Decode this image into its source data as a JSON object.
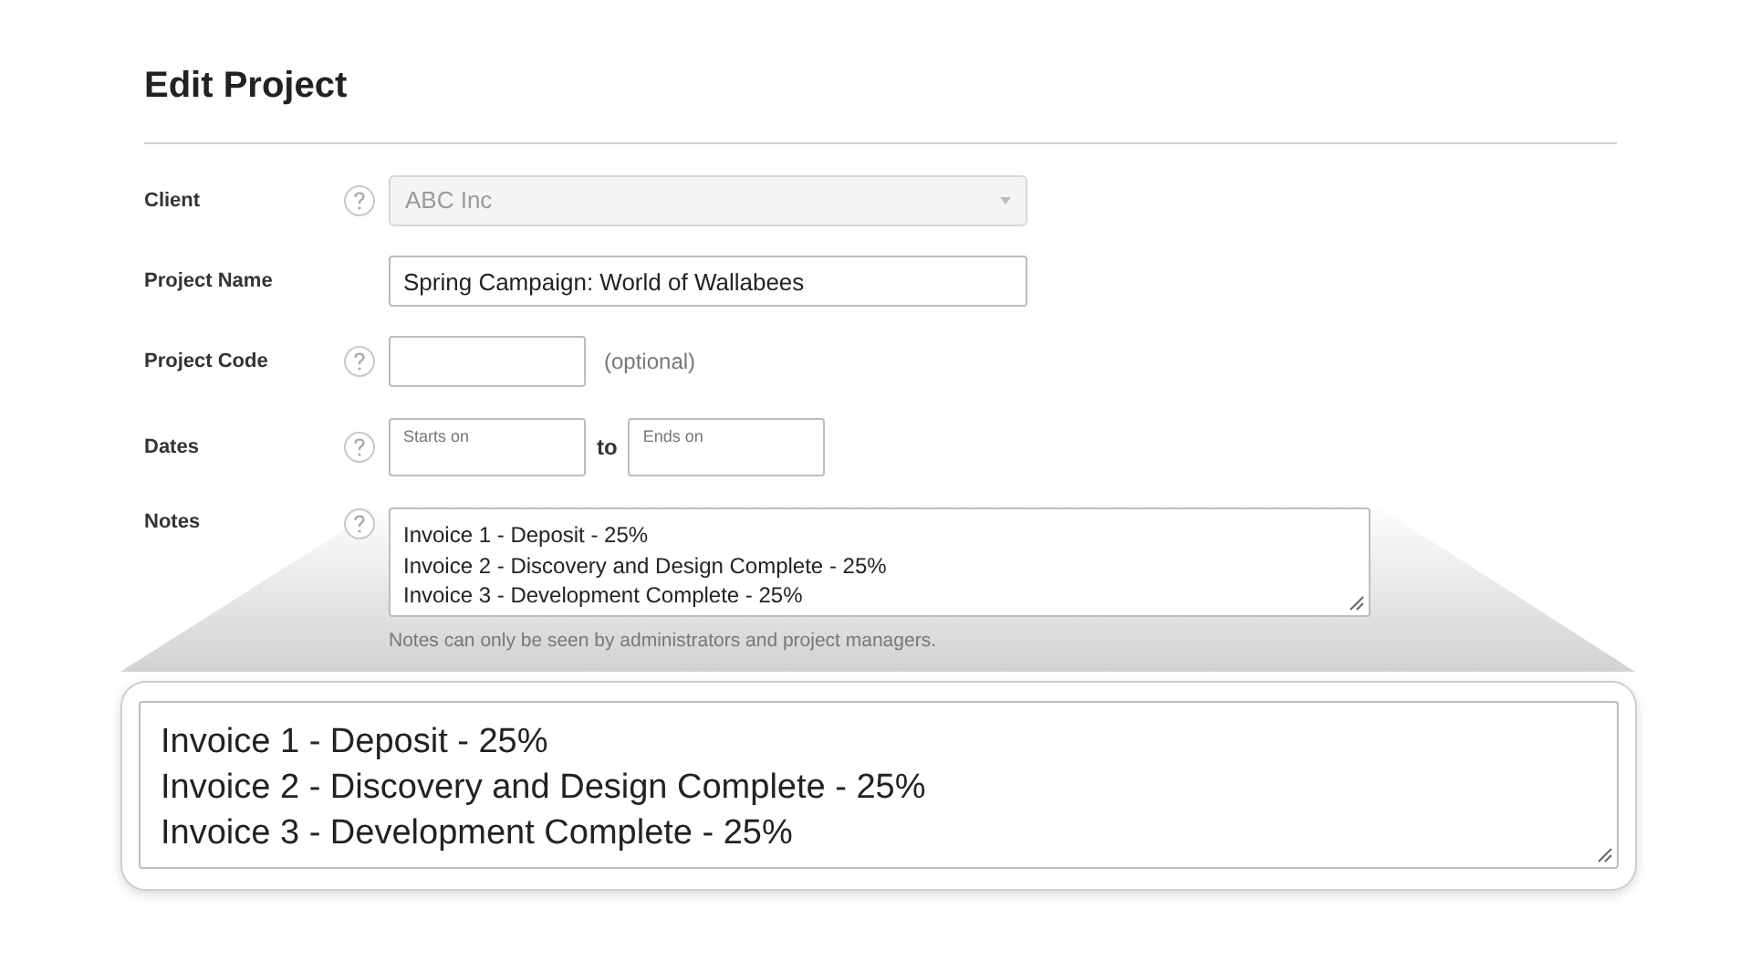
{
  "title": "Edit Project",
  "fields": [
    {
      "kind": "select",
      "label": "Client",
      "help": true,
      "value": "ABC Inc",
      "disabled": true
    },
    {
      "kind": "text",
      "label": "Project Name",
      "help": false,
      "value": "Spring Campaign: World of Wallabees"
    },
    {
      "kind": "short",
      "label": "Project Code",
      "help": true,
      "suffix": "(optional)"
    },
    {
      "kind": "daterange",
      "label": "Dates",
      "help": true,
      "start_placeholder": "Starts on",
      "separator": "to",
      "end_placeholder": "Ends on"
    },
    {
      "kind": "notes",
      "label": "Notes",
      "help": true,
      "lines": [
        "Invoice 1 - Deposit - 25%",
        "Invoice 2 - Discovery and Design Complete - 25%",
        "Invoice 3 - Development Complete - 25%"
      ],
      "hint": "Notes can only be seen by administrators and project managers."
    }
  ],
  "zoom": {
    "lines": [
      "Invoice 1 - Deposit - 25%",
      "Invoice 2 - Discovery and Design Complete - 25%",
      "Invoice 3 - Development Complete - 25%"
    ]
  }
}
